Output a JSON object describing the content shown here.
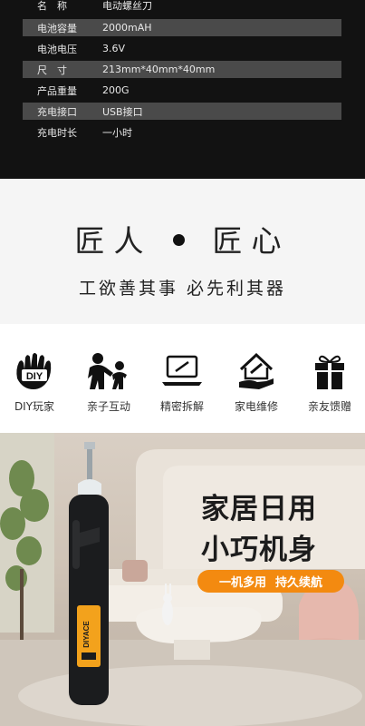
{
  "specs": [
    {
      "key": "名　称",
      "value": "电动螺丝刀"
    },
    {
      "key": "电池容量",
      "value": "2000mAH"
    },
    {
      "key": "电池电压",
      "value": "3.6V"
    },
    {
      "key": "尺　寸",
      "value": "213mm*40mm*40mm"
    },
    {
      "key": "产品重量",
      "value": "200G"
    },
    {
      "key": "充电接口",
      "value": "USB接口"
    },
    {
      "key": "充电时长",
      "value": "一小时"
    }
  ],
  "slogan": {
    "left": "匠人",
    "right": "匠心",
    "subtitle": "工欲善其事 必先利其器"
  },
  "features": [
    {
      "icon": "diy-hands-icon",
      "label": "DIY玩家"
    },
    {
      "icon": "parent-child-icon",
      "label": "亲子互动"
    },
    {
      "icon": "laptop-repair-icon",
      "label": "精密拆解"
    },
    {
      "icon": "home-repair-icon",
      "label": "家电维修"
    },
    {
      "icon": "gift-box-icon",
      "label": "亲友馈赠"
    }
  ],
  "hero": {
    "title_line1": "家居日用",
    "title_line2": "小巧机身",
    "tag_left": "一机多用",
    "tag_right": "持久续航",
    "brand_text": "DIYACE",
    "accent_color": "#f38a10"
  }
}
